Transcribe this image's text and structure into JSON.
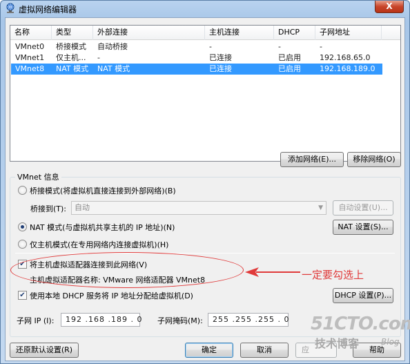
{
  "window": {
    "title": "虚拟网络编辑器",
    "close_label": "X"
  },
  "list": {
    "columns": [
      "名称",
      "类型",
      "外部连接",
      "主机连接",
      "DHCP",
      "子网地址"
    ],
    "rows": [
      {
        "name": "VMnet0",
        "type": "桥接模式",
        "external": "自动桥接",
        "host": "-",
        "dhcp": "-",
        "subnet": "-"
      },
      {
        "name": "VMnet1",
        "type": "仅主机...",
        "external": "-",
        "host": "已连接",
        "dhcp": "已启用",
        "subnet": "192.168.65.0"
      },
      {
        "name": "VMnet8",
        "type": "NAT 模式",
        "external": "NAT 模式",
        "host": "已连接",
        "dhcp": "已启用",
        "subnet": "192.168.189.0",
        "selected": true
      }
    ]
  },
  "buttons": {
    "add_network": "添加网络(E)...",
    "remove_network": "移除网络(O)",
    "auto_settings": "自动设置(U)...",
    "nat_settings": "NAT 设置(S)...",
    "dhcp_settings": "DHCP 设置(P)...",
    "restore_defaults": "还原默认设置(R)",
    "ok": "确定",
    "cancel": "取消",
    "apply": "应",
    "help": "帮助"
  },
  "vmnet_info": {
    "group_label": "VMnet 信息",
    "bridged_mode": "桥接模式(将虚拟机直接连接到外部网络)(B)",
    "bridged_to_label": "桥接到(T):",
    "bridged_to_value": "自动",
    "nat_mode": "NAT 模式(与虚拟机共享主机的 IP 地址)(N)",
    "host_only_mode": "仅主机模式(在专用网络内连接虚拟机)(H)",
    "selected_mode": "nat",
    "connect_adapter": "将主机虚拟适配器连接到此网络(V)",
    "connect_adapter_checked": true,
    "adapter_name": "主机虚拟适配器名称: VMware 网络适配器 VMnet8",
    "use_dhcp": "使用本地 DHCP 服务将 IP 地址分配给虚拟机(D)",
    "use_dhcp_checked": true,
    "subnet_ip_label": "子网 IP (I):",
    "subnet_ip_value": "192 .168 .189 . 0",
    "subnet_mask_label": "子网掩码(M):",
    "subnet_mask_value": "255 .255 .255 . 0"
  },
  "annotation": {
    "text": "一定要勾选上",
    "color": "#e03a3a"
  },
  "watermark": {
    "site": "51CTO.com",
    "line2": "技术博客",
    "blog": "Blog"
  },
  "colors": {
    "selection": "#3399ff",
    "title_bar": "#b9d3ef",
    "close_button": "#c8452a"
  },
  "icons": {
    "title_icon": "network-globe-icon",
    "dropdown": "chevron-down-icon",
    "check": "checkmark-icon"
  }
}
